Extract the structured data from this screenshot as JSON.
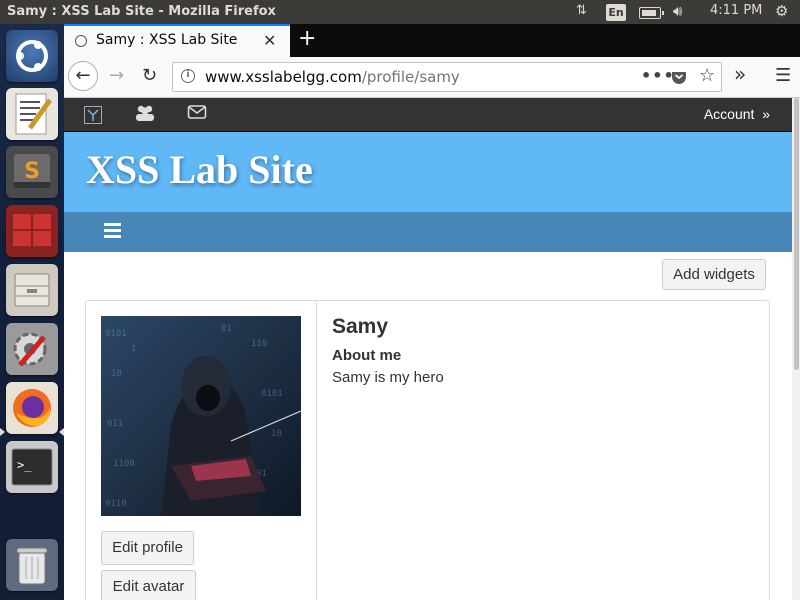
{
  "window": {
    "title": "Samy : XSS Lab Site - Mozilla Firefox",
    "clock": "4:11 PM",
    "keyboard_layout": "En"
  },
  "launcher": {
    "items": [
      {
        "name": "ubuntu-dash-icon",
        "color": "#2b4d7f"
      },
      {
        "name": "text-editor-icon",
        "color": "#dcdcd6"
      },
      {
        "name": "sublime-text-icon",
        "color": "#5b5b5b"
      },
      {
        "name": "workspace-switcher-icon",
        "color": "#7a1f1f"
      },
      {
        "name": "file-manager-icon",
        "color": "#b9b4a8"
      },
      {
        "name": "system-settings-icon",
        "color": "#8a8a8a"
      },
      {
        "name": "firefox-icon",
        "color": "#e8642a"
      },
      {
        "name": "terminal-icon",
        "color": "#2c2c2c"
      },
      {
        "name": "trash-icon",
        "color": "#9aa0a6"
      }
    ]
  },
  "browser": {
    "tab_title": "Samy : XSS Lab Site",
    "url_host": "www.xsslabelgg.com",
    "url_path": "/profile/samy",
    "accent": "#0a84ff"
  },
  "site": {
    "account_label": "Account",
    "account_arrow": "»",
    "site_name": "XSS Lab Site",
    "header_color": "#60b8f7",
    "menu_color": "#4787b8",
    "topbar_color": "#333333"
  },
  "profile": {
    "add_widgets_label": "Add widgets",
    "name": "Samy",
    "about_label": "About me",
    "about_text": "Samy is my hero",
    "edit_profile_label": "Edit profile",
    "edit_avatar_label": "Edit avatar"
  }
}
